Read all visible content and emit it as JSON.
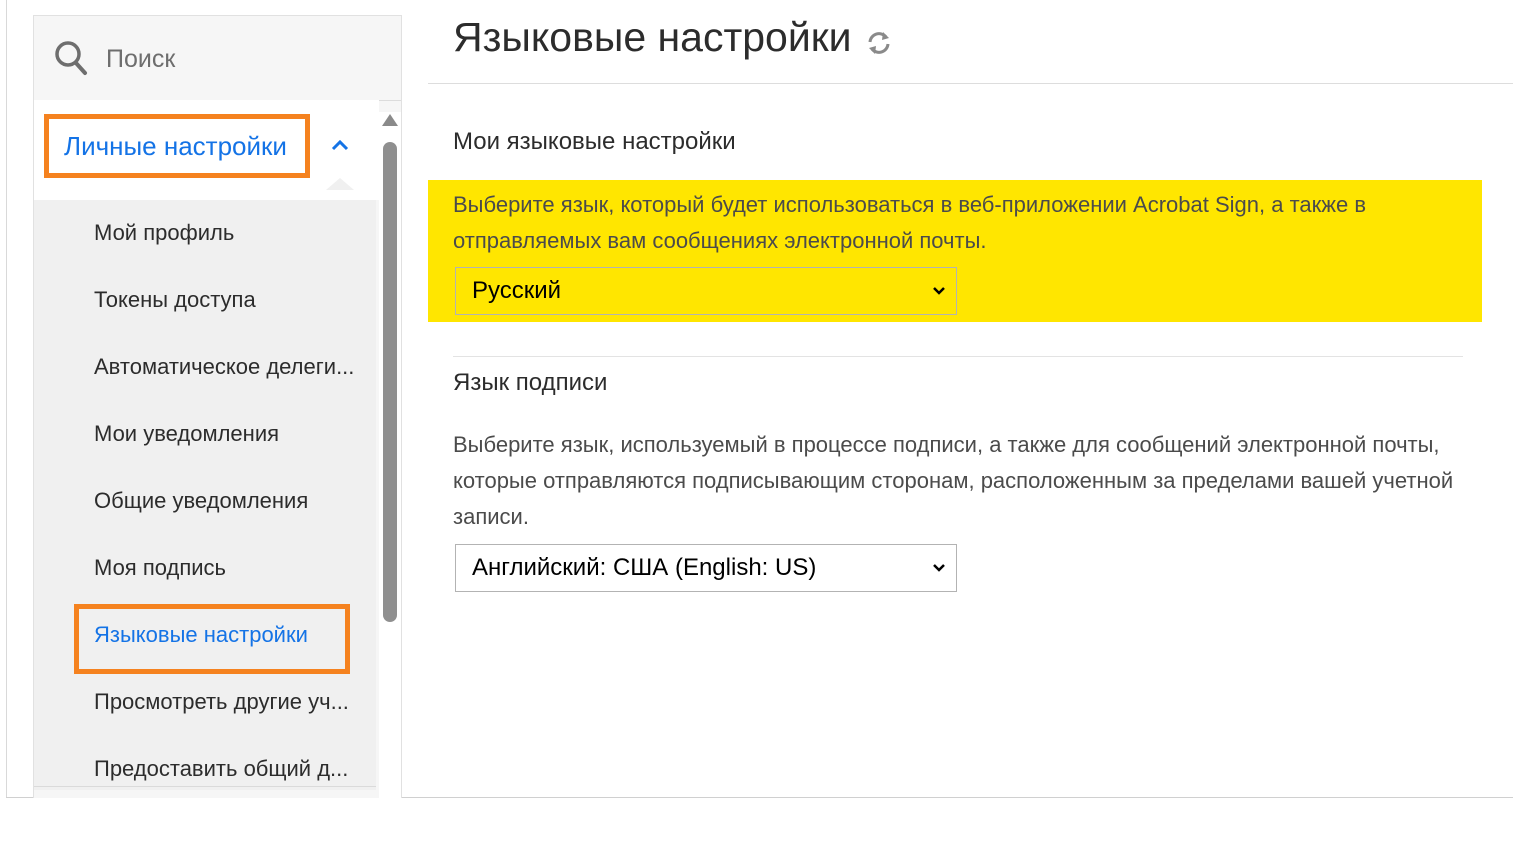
{
  "search": {
    "placeholder": "Поиск"
  },
  "sidebar": {
    "section_title": "Личные настройки",
    "items": [
      {
        "label": "Мой профиль"
      },
      {
        "label": "Токены доступа"
      },
      {
        "label": "Автоматическое делеги..."
      },
      {
        "label": "Мои уведомления"
      },
      {
        "label": "Общие уведомления"
      },
      {
        "label": "Моя подпись"
      },
      {
        "label": "Языковые настройки",
        "active": true
      },
      {
        "label": "Просмотреть другие уч..."
      },
      {
        "label": "Предоставить общий д..."
      }
    ]
  },
  "main": {
    "title": "Языковые настройки",
    "my_language": {
      "heading": "Мои языковые настройки",
      "description": "Выберите язык, который будет использоваться в веб-приложении Acrobat Sign, а также в отправляемых вам сообщениях электронной почты.",
      "selected": "Русский"
    },
    "signing_language": {
      "heading": "Язык подписи",
      "description": "Выберите язык, используемый в процессе подписи, а также для сообщений электронной почты, которые отправляются подписывающим сторонам, расположенным за пределами вашей учетной записи.",
      "selected": "Английский: США (English: US)"
    }
  },
  "colors": {
    "accent": "#1473e6",
    "annotation_outline": "#f5821f",
    "highlight": "#ffe600"
  },
  "icons": [
    "search-icon",
    "chevron-up-icon",
    "refresh-icon",
    "chevron-down-icon"
  ]
}
